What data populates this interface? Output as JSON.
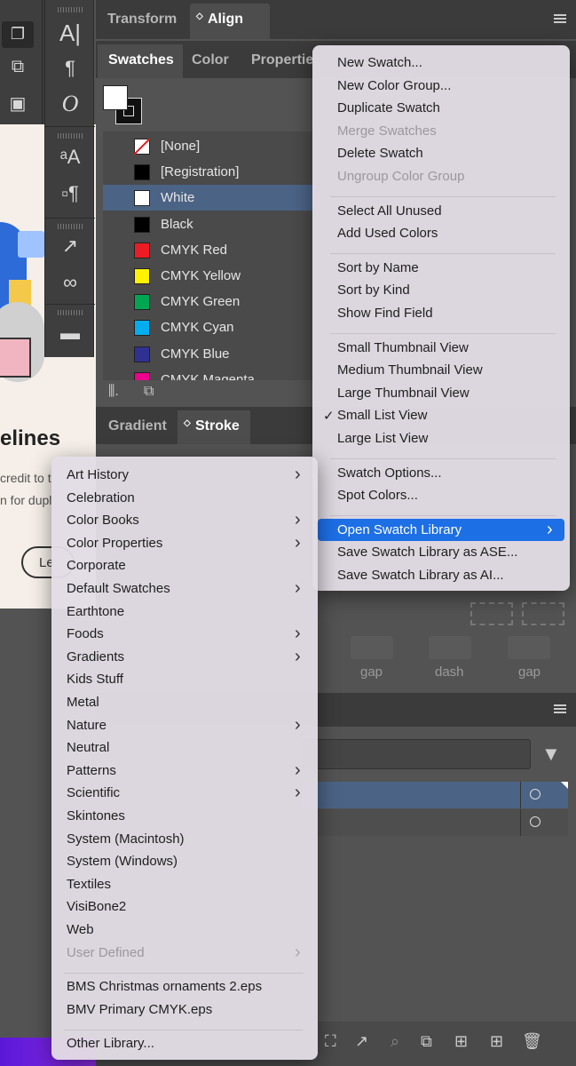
{
  "doc": {
    "heading": "elines",
    "line1": "credit to t",
    "line2": "n for dupl",
    "button": "Le"
  },
  "top_tabs": [
    {
      "label": "Transform",
      "active": false
    },
    {
      "label": "Align",
      "active": true
    }
  ],
  "swatch_tabs": [
    {
      "label": "Swatches",
      "active": true
    },
    {
      "label": "Color",
      "active": false
    },
    {
      "label": "Propertie",
      "active": false
    }
  ],
  "swatches": [
    {
      "name": "[None]",
      "color": "none"
    },
    {
      "name": "[Registration]",
      "color": "#000000"
    },
    {
      "name": "White",
      "color": "#ffffff",
      "selected": true
    },
    {
      "name": "Black",
      "color": "#000000"
    },
    {
      "name": "CMYK Red",
      "color": "#ed1c24"
    },
    {
      "name": "CMYK Yellow",
      "color": "#fff200"
    },
    {
      "name": "CMYK Green",
      "color": "#00a651"
    },
    {
      "name": "CMYK Cyan",
      "color": "#00aeef"
    },
    {
      "name": "CMYK Blue",
      "color": "#2e3192"
    },
    {
      "name": "CMYK Magenta",
      "color": "#ec008c"
    }
  ],
  "bottom_tabs": [
    {
      "label": "Gradient",
      "active": false
    },
    {
      "label": "Stroke",
      "active": true
    }
  ],
  "stroke_labels": [
    "gap",
    "dash",
    "gap"
  ],
  "flyout_menu": [
    {
      "label": "New Swatch..."
    },
    {
      "label": "New Color Group..."
    },
    {
      "label": "Duplicate Swatch"
    },
    {
      "label": "Merge Swatches",
      "disabled": true
    },
    {
      "label": "Delete Swatch"
    },
    {
      "label": "Ungroup Color Group",
      "disabled": true
    },
    {
      "sep": true
    },
    {
      "label": "Select All Unused"
    },
    {
      "label": "Add Used Colors"
    },
    {
      "sep": true
    },
    {
      "label": "Sort by Name"
    },
    {
      "label": "Sort by Kind"
    },
    {
      "label": "Show Find Field"
    },
    {
      "sep": true
    },
    {
      "label": "Small Thumbnail View"
    },
    {
      "label": "Medium Thumbnail View"
    },
    {
      "label": "Large Thumbnail View"
    },
    {
      "label": "Small List View",
      "checked": true
    },
    {
      "label": "Large List View"
    },
    {
      "sep": true
    },
    {
      "label": "Swatch Options..."
    },
    {
      "label": "Spot Colors..."
    },
    {
      "sep": true
    },
    {
      "label": "Open Swatch Library",
      "submenu": true,
      "highlighted": true
    },
    {
      "label": "Save Swatch Library as ASE..."
    },
    {
      "label": "Save Swatch Library as AI..."
    }
  ],
  "check_mark": "✓",
  "library_menu": [
    {
      "label": "Art History",
      "submenu": true
    },
    {
      "label": "Celebration"
    },
    {
      "label": "Color Books",
      "submenu": true
    },
    {
      "label": "Color Properties",
      "submenu": true
    },
    {
      "label": "Corporate"
    },
    {
      "label": "Default Swatches",
      "submenu": true
    },
    {
      "label": "Earthtone"
    },
    {
      "label": "Foods",
      "submenu": true
    },
    {
      "label": "Gradients",
      "submenu": true
    },
    {
      "label": "Kids Stuff"
    },
    {
      "label": "Metal"
    },
    {
      "label": "Nature",
      "submenu": true
    },
    {
      "label": "Neutral"
    },
    {
      "label": "Patterns",
      "submenu": true
    },
    {
      "label": "Scientific",
      "submenu": true
    },
    {
      "label": "Skintones"
    },
    {
      "label": "System (Macintosh)"
    },
    {
      "label": "System (Windows)"
    },
    {
      "label": "Textiles"
    },
    {
      "label": "VisiBone2"
    },
    {
      "label": "Web"
    },
    {
      "label": "User Defined",
      "submenu": true,
      "disabled": true
    },
    {
      "sep": true
    },
    {
      "label": "BMS Christmas ornaments 2.eps"
    },
    {
      "label": "BMV Primary CMYK.eps"
    },
    {
      "sep": true
    },
    {
      "label": "Other Library..."
    }
  ],
  "colors": {
    "accent": "#1d6fe6",
    "selection": "#4b6385",
    "panel": "#535353"
  }
}
